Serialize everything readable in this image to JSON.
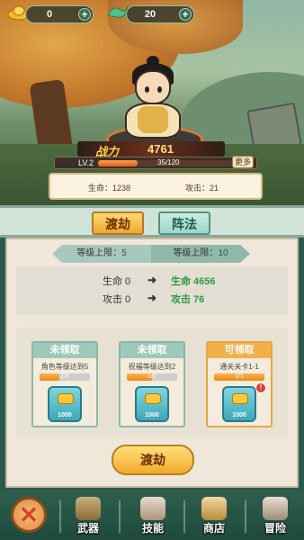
{
  "resources": {
    "gold": {
      "value": "0",
      "icon": "gold-ingot-icon"
    },
    "jade": {
      "value": "20",
      "icon": "jade-icon"
    }
  },
  "hero": {
    "power_label": "战力",
    "power_value": "4761",
    "level": "LV.2",
    "exp_current": 35,
    "exp_max": 120,
    "exp_text": "35/120",
    "more_label": "更多",
    "hp_label": "生命：1238",
    "atk_label": "攻击：21"
  },
  "tabs": [
    {
      "label": "渡劫",
      "active": true
    },
    {
      "label": "阵法",
      "active": false
    }
  ],
  "limits": {
    "left_label": "等级上限：",
    "left_value": "5",
    "right_label": "等级上限：",
    "right_value": "10"
  },
  "compare": {
    "hp_from": "生命 0",
    "hp_to": "生命 4656",
    "atk_from": "攻击 0",
    "atk_to": "攻击 76",
    "arrow": "➜"
  },
  "rewards": [
    {
      "status": "未领取",
      "condition": "角色等级达到5",
      "progress": "2/5",
      "progress_value": 0.4,
      "amount": "1000",
      "claimable": false
    },
    {
      "status": "未领取",
      "condition": "祝福等级达到2",
      "progress": "1/2",
      "progress_value": 0.5,
      "amount": "1000",
      "claimable": false
    },
    {
      "status": "可领取",
      "condition": "通关关卡1-1",
      "progress": "1/1",
      "progress_value": 1.0,
      "amount": "1000",
      "claimable": true,
      "badge": "!"
    }
  ],
  "cta_label": "渡劫",
  "nav": {
    "close_glyph": "✕",
    "items": [
      {
        "label": "武器",
        "icon": "weapon-icon"
      },
      {
        "label": "技能",
        "icon": "skill-icon"
      },
      {
        "label": "商店",
        "icon": "shop-icon"
      },
      {
        "label": "冒险",
        "icon": "adventure-icon"
      }
    ]
  },
  "colors": {
    "accent_orange": "#f0a82e",
    "teal": "#9fd6c8",
    "green_value": "#2e9a3e",
    "nav_bg": "#2d5f4f"
  }
}
